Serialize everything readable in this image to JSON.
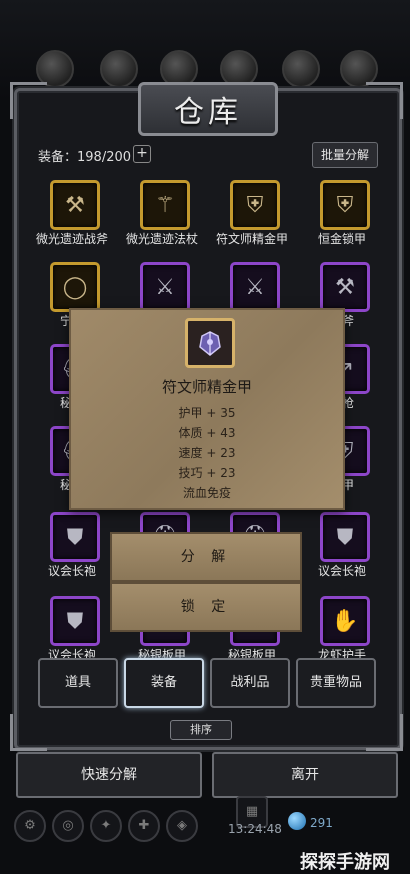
{
  "header": {
    "title": "仓库"
  },
  "toolbar": {
    "capacity": "装备：198/200",
    "plus": "+",
    "bulk_decompose": "批量分解"
  },
  "items": [
    {
      "label": "微光遗迹战斧",
      "rarity": "gold",
      "icon": "axe-icon"
    },
    {
      "label": "微光遗迹法杖",
      "rarity": "gold",
      "icon": "staff-icon"
    },
    {
      "label": "符文师精金甲",
      "rarity": "gold",
      "icon": "armor-icon"
    },
    {
      "label": "恒金锁甲",
      "rarity": "gold",
      "icon": "chainmail-icon"
    },
    {
      "label": "宁静",
      "rarity": "gold",
      "icon": "ring-icon"
    },
    {
      "label": "",
      "rarity": "purple",
      "icon": "greatsword-icon"
    },
    {
      "label": "",
      "rarity": "purple",
      "icon": "sword-icon"
    },
    {
      "label": "战斧",
      "rarity": "purple",
      "icon": "battleaxe-icon"
    },
    {
      "label": "秘银",
      "rarity": "purple",
      "icon": "helm-icon"
    },
    {
      "label": "猎枪",
      "rarity": "purple",
      "icon": "spear-icon"
    },
    {
      "label": "秘银",
      "rarity": "purple",
      "icon": "helm-icon"
    },
    {
      "label": "族甲",
      "rarity": "purple",
      "icon": "plate-icon"
    },
    {
      "label": "议会长袍",
      "rarity": "purple",
      "icon": "robe-icon"
    },
    {
      "label": "",
      "rarity": "purple",
      "icon": "helm-icon"
    },
    {
      "label": "",
      "rarity": "purple",
      "icon": "helm-icon"
    },
    {
      "label": "议会长袍",
      "rarity": "purple",
      "icon": "robe-icon"
    },
    {
      "label": "议会长袍",
      "rarity": "purple",
      "icon": "robe-icon"
    },
    {
      "label": "秘银板甲",
      "rarity": "purple",
      "icon": "plate-icon"
    },
    {
      "label": "秘银板甲",
      "rarity": "purple",
      "icon": "plate-icon"
    },
    {
      "label": "龙虾护手",
      "rarity": "purple",
      "icon": "gauntlet-icon"
    }
  ],
  "popup": {
    "name": "符文师精金甲",
    "icon": "armor-icon",
    "stats": [
      "护甲 + 35",
      "体质 + 43",
      "速度 + 23",
      "技巧 + 23",
      "流血免疫"
    ],
    "decompose": "分 解",
    "lock": "锁 定"
  },
  "tabs": [
    {
      "label": "道具",
      "active": false
    },
    {
      "label": "装备",
      "active": true
    },
    {
      "label": "战利品",
      "active": false
    },
    {
      "label": "贵重物品",
      "active": false
    }
  ],
  "sort": "排序",
  "bottom": {
    "quick_decompose": "快速分解",
    "leave": "离开"
  },
  "status": {
    "time": "13:24:48",
    "gems": "291"
  },
  "watermark": "探探手游网",
  "colors": {
    "gold_frame": "#c49a2e",
    "purple_frame": "#8d46c9",
    "paper": "#9c8665"
  }
}
